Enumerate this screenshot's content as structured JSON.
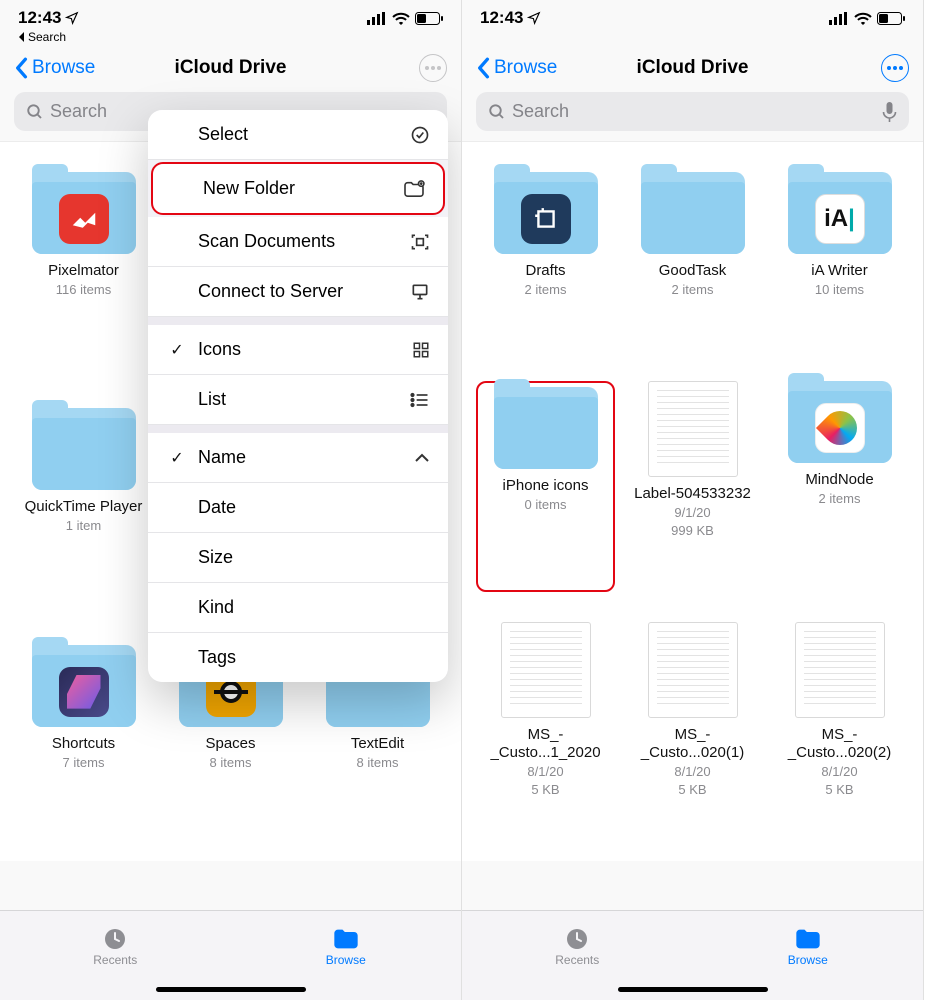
{
  "status": {
    "time": "12:43",
    "back_to": "Search"
  },
  "nav": {
    "back_label": "Browse",
    "title": "iCloud Drive"
  },
  "search": {
    "placeholder": "Search"
  },
  "menu": {
    "select": "Select",
    "new_folder": "New Folder",
    "scan": "Scan Documents",
    "connect": "Connect to Server",
    "icons": "Icons",
    "list": "List",
    "name": "Name",
    "date": "Date",
    "size": "Size",
    "kind": "Kind",
    "tags": "Tags"
  },
  "left_items": [
    {
      "name": "Pixelmator",
      "sub": "116 items"
    },
    {
      "name": "QuickTime Player",
      "sub": "1 item"
    },
    {
      "name": "Shortcuts",
      "sub": "7 items"
    },
    {
      "name": "Spaces",
      "sub": "8 items"
    },
    {
      "name": "TextEdit",
      "sub": "8 items"
    }
  ],
  "right_items": [
    {
      "name": "Drafts",
      "sub": "2 items"
    },
    {
      "name": "GoodTask",
      "sub": "2 items"
    },
    {
      "name": "iA Writer",
      "sub": "10 items"
    },
    {
      "name": "iPhone icons",
      "sub": "0 items"
    },
    {
      "name": "Label-504533232",
      "sub": "9/1/20",
      "sub2": "999 KB"
    },
    {
      "name": "MindNode",
      "sub": "2 items"
    },
    {
      "name": "MS_-_Custo...1_2020",
      "sub": "8/1/20",
      "sub2": "5 KB"
    },
    {
      "name": "MS_-_Custo...020(1)",
      "sub": "8/1/20",
      "sub2": "5 KB"
    },
    {
      "name": "MS_-_Custo...020(2)",
      "sub": "8/1/20",
      "sub2": "5 KB"
    }
  ],
  "tabs": {
    "recents": "Recents",
    "browse": "Browse"
  }
}
